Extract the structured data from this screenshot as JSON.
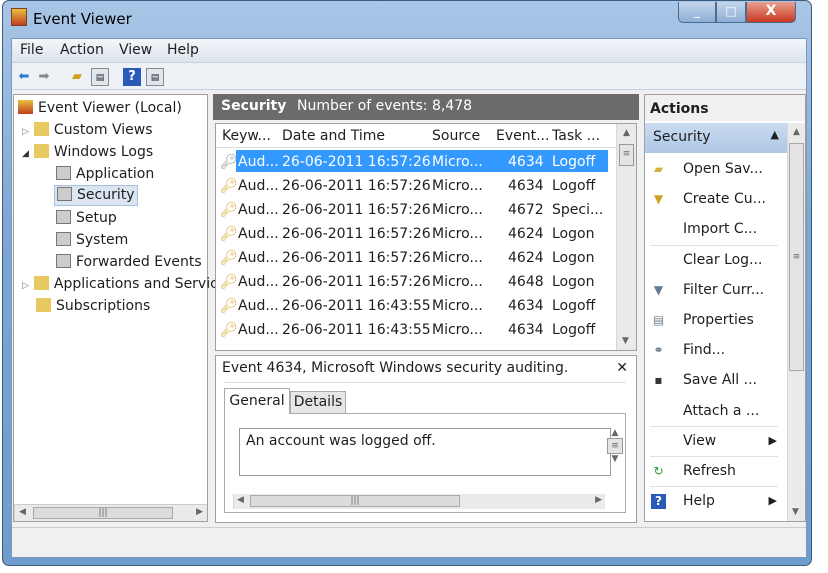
{
  "window": {
    "title": "Event Viewer",
    "min": "_",
    "max": "□",
    "close": "X"
  },
  "menu": [
    "File",
    "Action",
    "View",
    "Help"
  ],
  "tree": {
    "root": "Event Viewer (Local)",
    "items": [
      {
        "label": "Custom Views",
        "level": 1
      },
      {
        "label": "Windows Logs",
        "level": 1
      },
      {
        "label": "Application",
        "level": 2
      },
      {
        "label": "Security",
        "level": 2,
        "selected": true
      },
      {
        "label": "Setup",
        "level": 2
      },
      {
        "label": "System",
        "level": 2
      },
      {
        "label": "Forwarded Events",
        "level": 2
      },
      {
        "label": "Applications and Servic",
        "level": 1
      },
      {
        "label": "Subscriptions",
        "level": 1
      }
    ]
  },
  "log": {
    "name": "Security",
    "count_text": "Number of events: 8,478"
  },
  "columns": [
    "Keyw...",
    "Date and Time",
    "Source",
    "Event...",
    "Task ..."
  ],
  "events": [
    {
      "keyword": "Aud...",
      "date": "26-06-2011 16:57:26",
      "source": "Micro...",
      "id": "4634",
      "task": "Logoff"
    },
    {
      "keyword": "Aud...",
      "date": "26-06-2011 16:57:26",
      "source": "Micro...",
      "id": "4634",
      "task": "Logoff"
    },
    {
      "keyword": "Aud...",
      "date": "26-06-2011 16:57:26",
      "source": "Micro...",
      "id": "4672",
      "task": "Speci..."
    },
    {
      "keyword": "Aud...",
      "date": "26-06-2011 16:57:26",
      "source": "Micro...",
      "id": "4624",
      "task": "Logon"
    },
    {
      "keyword": "Aud...",
      "date": "26-06-2011 16:57:26",
      "source": "Micro...",
      "id": "4624",
      "task": "Logon"
    },
    {
      "keyword": "Aud...",
      "date": "26-06-2011 16:57:26",
      "source": "Micro...",
      "id": "4648",
      "task": "Logon"
    },
    {
      "keyword": "Aud...",
      "date": "26-06-2011 16:43:55",
      "source": "Micro...",
      "id": "4634",
      "task": "Logoff"
    },
    {
      "keyword": "Aud...",
      "date": "26-06-2011 16:43:55",
      "source": "Micro...",
      "id": "4634",
      "task": "Logoff"
    }
  ],
  "detail": {
    "title": "Event 4634, Microsoft Windows security auditing.",
    "close": "✕",
    "tabs": [
      "General",
      "Details"
    ],
    "text": "An account was logged off."
  },
  "actions": {
    "header": "Actions",
    "section": "Security",
    "items": [
      {
        "label": "Open Sav...",
        "icon": "folder-open-icon"
      },
      {
        "label": "Create Cu...",
        "icon": "filter-create-icon"
      },
      {
        "label": "Import C...",
        "icon": ""
      },
      {
        "label": "Clear Log...",
        "icon": ""
      },
      {
        "label": "Filter Curr...",
        "icon": "filter-icon"
      },
      {
        "label": "Properties",
        "icon": "properties-icon"
      },
      {
        "label": "Find...",
        "icon": "binoculars-icon"
      },
      {
        "label": "Save All ...",
        "icon": "floppy-icon"
      },
      {
        "label": "Attach a ...",
        "icon": ""
      },
      {
        "label": "View",
        "icon": "",
        "submenu": true
      },
      {
        "label": "Refresh",
        "icon": "refresh-icon"
      },
      {
        "label": "Help",
        "icon": "help-icon",
        "submenu": true
      }
    ]
  },
  "colors": {
    "selection": "#3399ff",
    "header_bar": "#6b6b6b",
    "actions_section": "#bcd2ea"
  }
}
